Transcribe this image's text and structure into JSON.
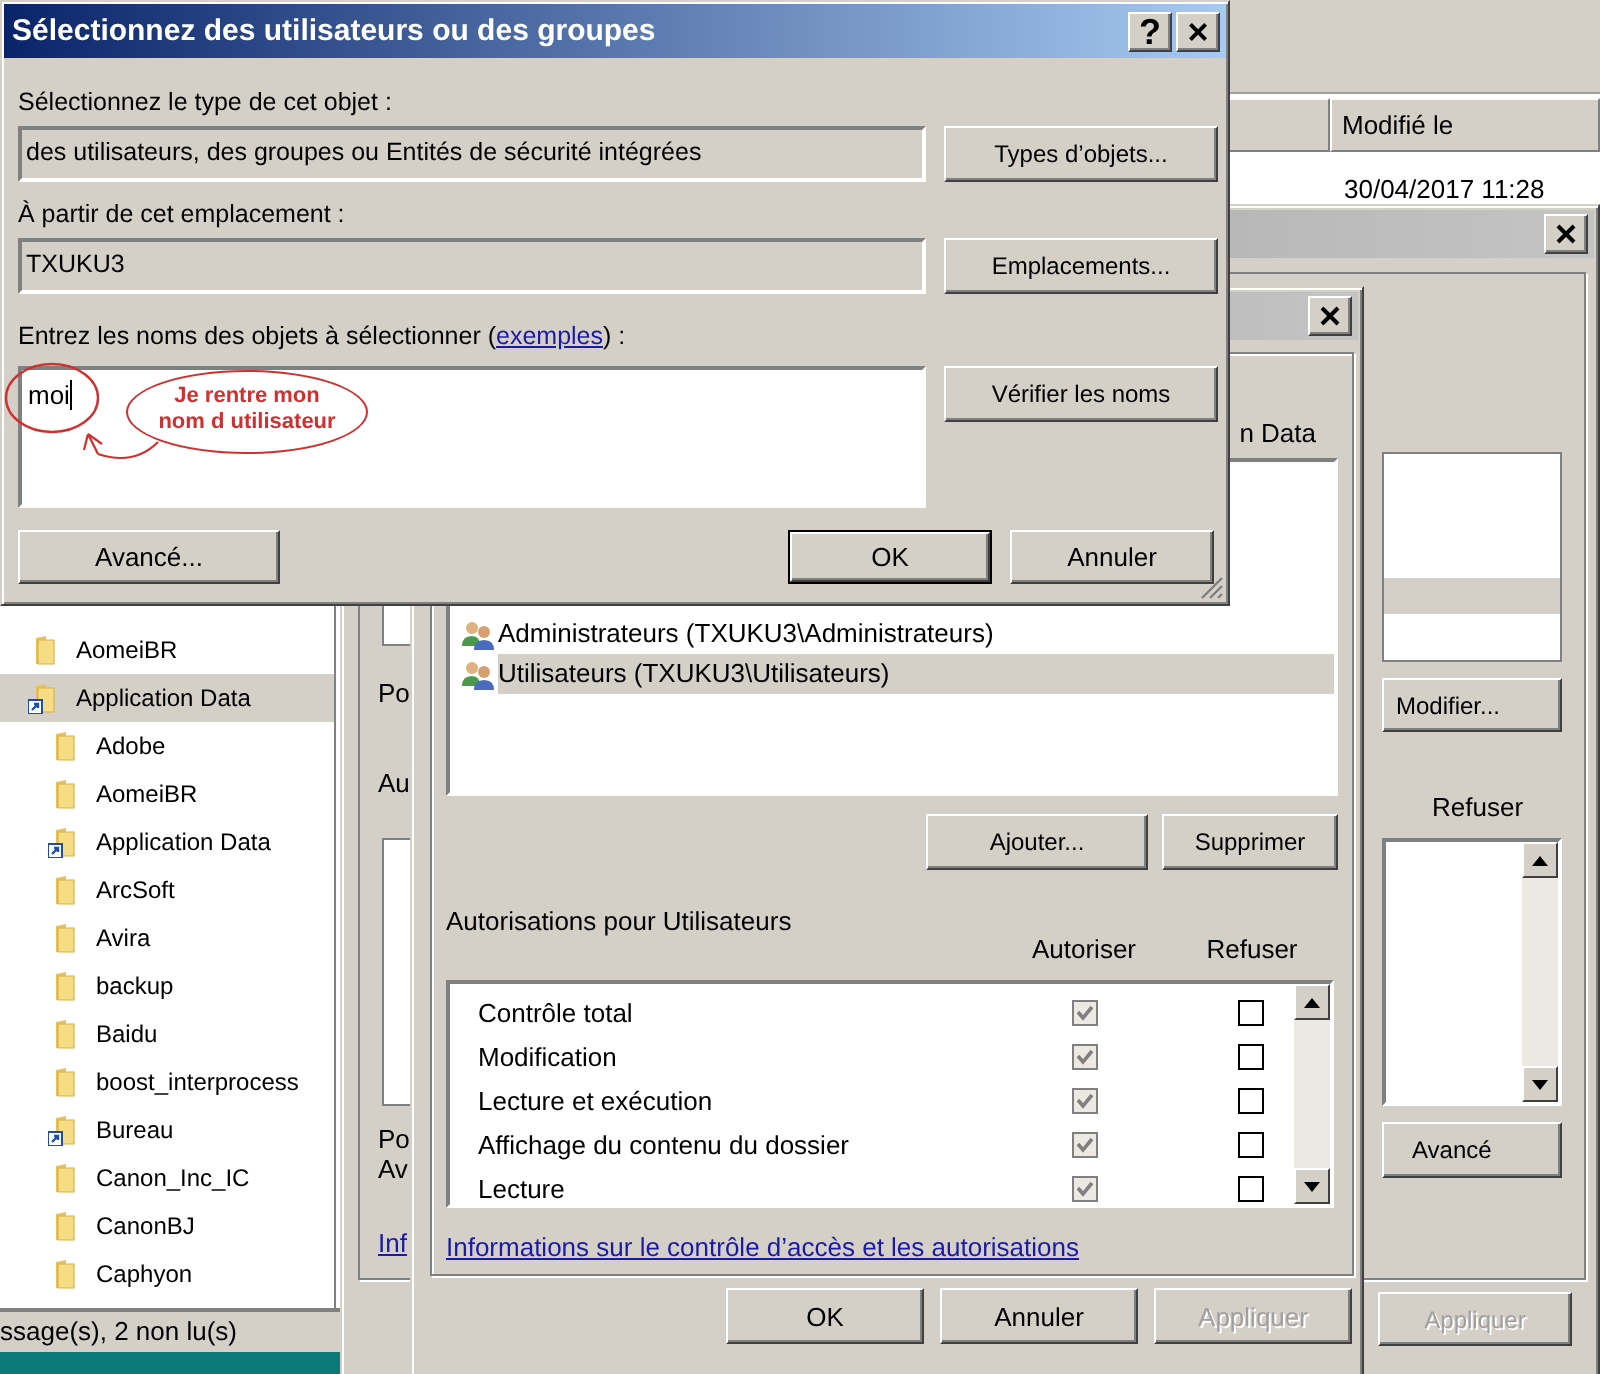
{
  "explorer": {
    "column_header": "Modifié le",
    "date_cell": "30/04/2017 11:28",
    "tree": [
      {
        "label": "AomeiBR",
        "selected": false,
        "shortcut": false
      },
      {
        "label": "Application Data",
        "selected": true,
        "shortcut": true,
        "children": [
          {
            "label": "Adobe",
            "selected": false,
            "shortcut": false
          },
          {
            "label": "AomeiBR",
            "selected": false,
            "shortcut": false
          },
          {
            "label": "Application Data",
            "selected": false,
            "shortcut": true
          },
          {
            "label": "ArcSoft",
            "selected": false,
            "shortcut": false
          },
          {
            "label": "Avira",
            "selected": false,
            "shortcut": false
          },
          {
            "label": "backup",
            "selected": false,
            "shortcut": false
          },
          {
            "label": "Baidu",
            "selected": false,
            "shortcut": false
          },
          {
            "label": "boost_interprocess",
            "selected": false,
            "shortcut": false
          },
          {
            "label": "Bureau",
            "selected": false,
            "shortcut": true
          },
          {
            "label": "Canon_Inc_IC",
            "selected": false,
            "shortcut": false
          },
          {
            "label": "CanonBJ",
            "selected": false,
            "shortcut": false
          },
          {
            "label": "Caphyon",
            "selected": false,
            "shortcut": false
          }
        ]
      }
    ],
    "status_bar": "ssage(s), 2 non lu(s)"
  },
  "properties_window": {
    "fragments": [
      "Po",
      "Au",
      "Po",
      "Av"
    ],
    "link_fragment": "Inf",
    "modify_button": "Modifier...",
    "deny_header": "Refuser",
    "advanced_button": "Avancé",
    "apply_button": {
      "label": "Appliquer",
      "disabled": true
    }
  },
  "permissions_window": {
    "object_name": "n Data",
    "users": [
      {
        "label": "Administrateurs (TXUKU3\\Administrateurs)",
        "selected": false
      },
      {
        "label": "Utilisateurs (TXUKU3\\Utilisateurs)",
        "selected": true
      }
    ],
    "add_button": "Ajouter...",
    "remove_button": "Supprimer",
    "permissions_label": "Autorisations pour Utilisateurs",
    "allow_header": "Autoriser",
    "deny_header": "Refuser",
    "permissions": [
      {
        "label": "Contrôle total",
        "allow": {
          "checked": true,
          "disabled": true
        },
        "deny": {
          "checked": false,
          "disabled": false
        }
      },
      {
        "label": "Modification",
        "allow": {
          "checked": true,
          "disabled": true
        },
        "deny": {
          "checked": false,
          "disabled": false
        }
      },
      {
        "label": "Lecture et exécution",
        "allow": {
          "checked": true,
          "disabled": true
        },
        "deny": {
          "checked": false,
          "disabled": false
        }
      },
      {
        "label": "Affichage du contenu du dossier",
        "allow": {
          "checked": true,
          "disabled": true
        },
        "deny": {
          "checked": false,
          "disabled": false
        }
      },
      {
        "label": "Lecture",
        "allow": {
          "checked": true,
          "disabled": true
        },
        "deny": {
          "checked": false,
          "disabled": false
        }
      }
    ],
    "help_link": "Informations sur le contrôle d’accès et les autorisations",
    "buttons": [
      {
        "label": "OK",
        "disabled": false
      },
      {
        "label": "Annuler",
        "disabled": false
      },
      {
        "label": "Appliquer",
        "disabled": true
      }
    ]
  },
  "select_dialog": {
    "title": "Sélectionnez des utilisateurs ou des groupes",
    "help_button": "?",
    "close_button": "×",
    "type_label": "Sélectionnez le type de cet objet :",
    "type_value": "des utilisateurs, des groupes ou Entités de sécurité intégrées",
    "types_button": "Types d’objets...",
    "location_label": "À partir de cet emplacement :",
    "location_value": "TXUKU3",
    "locations_button": "Emplacements...",
    "names_label_before": "Entrez les noms des objets à sélectionner (",
    "examples_link": "exemples",
    "names_label_after": ") :",
    "names_value": "moi",
    "check_names_button": "Vérifier les noms",
    "advanced_button": "Avancé...",
    "ok_button": "OK",
    "cancel_button": "Annuler",
    "annotation": "Je rentre mon nom d utilisateur"
  }
}
